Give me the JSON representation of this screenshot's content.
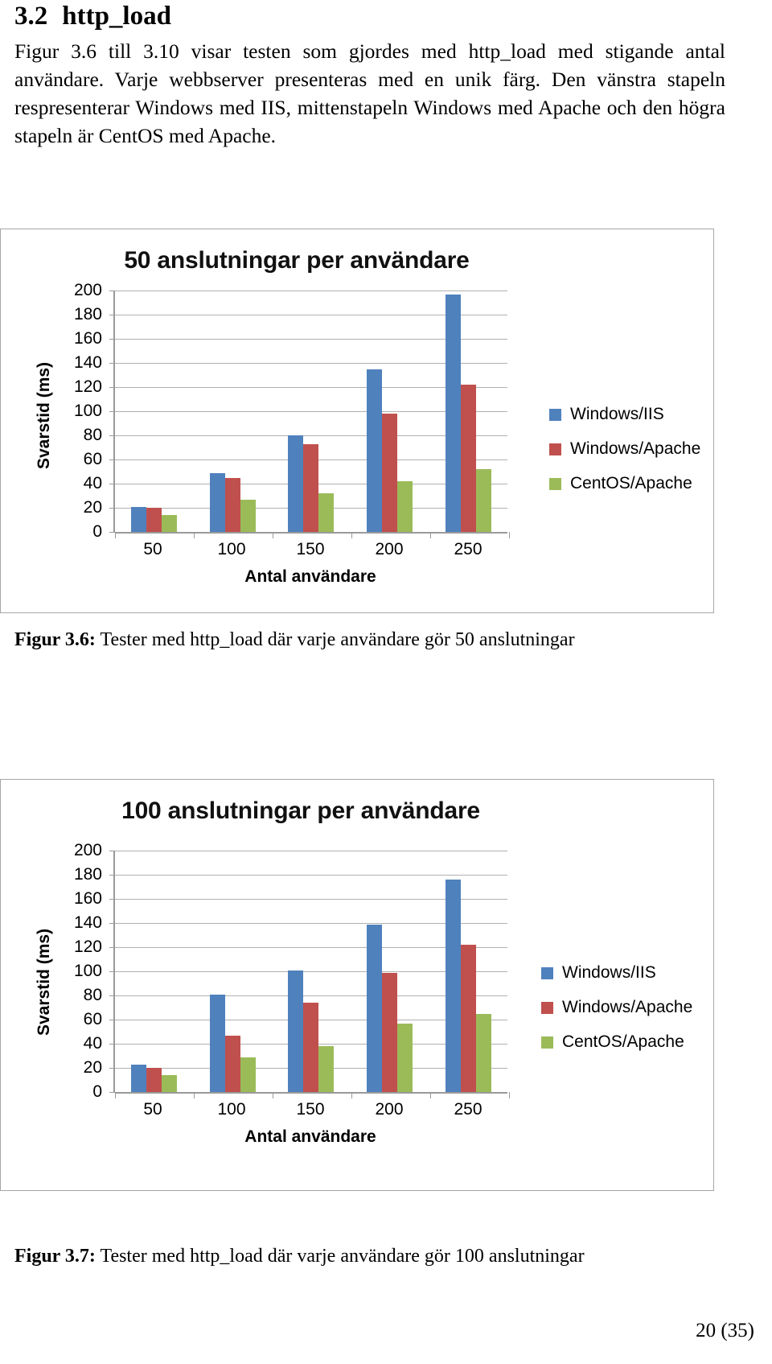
{
  "document": {
    "section_number": "3.2",
    "section_title": "http_load",
    "body_paragraph": "Figur 3.6 till 3.10 visar testen som gjordes med http_load med stigande antal användare. Varje webbserver presenteras med en unik färg. Den vänstra stapeln respresenterar Windows med IIS, mittenstapeln Windows med Apache och den högra stapeln är CentOS med Apache.",
    "page_number": "20 (35)"
  },
  "figure1": {
    "caption_label": "Figur 3.6:",
    "caption_text": " Tester med http_load där varje användare gör 50 anslutningar"
  },
  "figure2": {
    "caption_label": "Figur 3.7:",
    "caption_text": " Tester med http_load där varje användare gör 100 anslutningar"
  },
  "colors": {
    "windows_iis": "#4f81bd",
    "windows_apache": "#c0504d",
    "centos_apache": "#9bbb59",
    "gridline": "#b0b0b0",
    "axis": "#9a9a9a",
    "frame": "#a6a6a6"
  },
  "chart_data": [
    {
      "type": "bar",
      "title": "50 anslutningar per användare",
      "xlabel": "Antal användare",
      "ylabel": "Svarstid (ms)",
      "categories": [
        "50",
        "100",
        "150",
        "200",
        "250"
      ],
      "yticks": [
        "200",
        "180",
        "160",
        "140",
        "120",
        "100",
        "80",
        "60",
        "40",
        "20",
        "0"
      ],
      "ylim": [
        0,
        200
      ],
      "grid": true,
      "legend_position": "right",
      "series": [
        {
          "name": "Windows/IIS",
          "color": "#4f81bd",
          "values": [
            21,
            49,
            80,
            135,
            197
          ]
        },
        {
          "name": "Windows/Apache",
          "color": "#c0504d",
          "values": [
            20,
            45,
            73,
            98,
            122
          ]
        },
        {
          "name": "CentOS/Apache",
          "color": "#9bbb59",
          "values": [
            14,
            27,
            32,
            42,
            52
          ]
        }
      ]
    },
    {
      "type": "bar",
      "title": "100 anslutningar per användare",
      "xlabel": "Antal användare",
      "ylabel": "Svarstid (ms)",
      "categories": [
        "50",
        "100",
        "150",
        "200",
        "250"
      ],
      "yticks": [
        "200",
        "180",
        "160",
        "140",
        "120",
        "100",
        "80",
        "60",
        "40",
        "20",
        "0"
      ],
      "ylim": [
        0,
        200
      ],
      "grid": true,
      "legend_position": "right",
      "series": [
        {
          "name": "Windows/IIS",
          "color": "#4f81bd",
          "values": [
            23,
            81,
            101,
            139,
            176
          ]
        },
        {
          "name": "Windows/Apache",
          "color": "#c0504d",
          "values": [
            20,
            47,
            74,
            99,
            122
          ]
        },
        {
          "name": "CentOS/Apache",
          "color": "#9bbb59",
          "values": [
            14,
            29,
            38,
            57,
            65
          ]
        }
      ]
    }
  ]
}
